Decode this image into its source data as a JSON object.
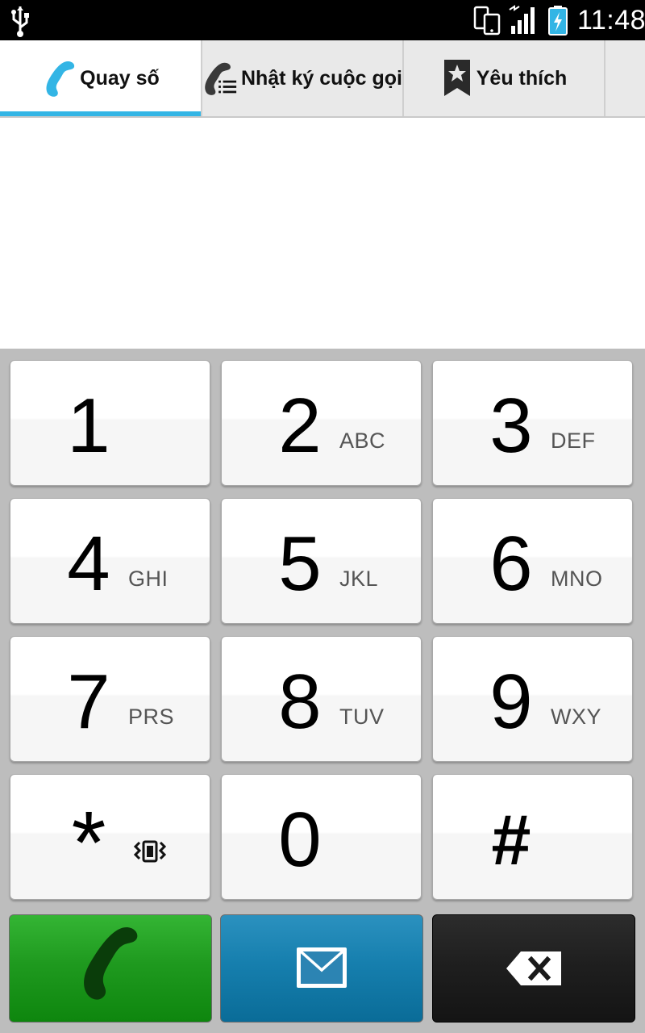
{
  "status_bar": {
    "time": "11:48",
    "icons": [
      "usb-icon",
      "phone-sync-icon",
      "signal-icon",
      "battery-charging-icon"
    ]
  },
  "tabs": [
    {
      "label": "Quay số",
      "icon": "phone-handset-icon",
      "active": true
    },
    {
      "label": "Nhật ký cuộc gọi",
      "icon": "call-log-icon",
      "active": false
    },
    {
      "label": "Yêu thích",
      "icon": "bookmark-star-icon",
      "active": false
    }
  ],
  "keypad": {
    "keys": [
      {
        "digit": "1",
        "letters": ""
      },
      {
        "digit": "2",
        "letters": "ABC"
      },
      {
        "digit": "3",
        "letters": "DEF"
      },
      {
        "digit": "4",
        "letters": "GHI"
      },
      {
        "digit": "5",
        "letters": "JKL"
      },
      {
        "digit": "6",
        "letters": "MNO"
      },
      {
        "digit": "7",
        "letters": "PRS"
      },
      {
        "digit": "8",
        "letters": "TUV"
      },
      {
        "digit": "9",
        "letters": "WXY"
      },
      {
        "digit": "*",
        "letters": "",
        "icon": "vibrate-icon"
      },
      {
        "digit": "0",
        "letters": ""
      },
      {
        "digit": "#",
        "letters": ""
      }
    ]
  },
  "actions": [
    {
      "name": "call",
      "icon": "phone-call-icon",
      "color": "#1f9a1f"
    },
    {
      "name": "message",
      "icon": "envelope-icon",
      "color": "#167fae"
    },
    {
      "name": "delete",
      "icon": "backspace-icon",
      "color": "#1f1f1f"
    }
  ],
  "colors": {
    "accent": "#33b5e5",
    "tab_bg": "#e9e9e9",
    "keypad_bg": "#bdbdbd"
  }
}
